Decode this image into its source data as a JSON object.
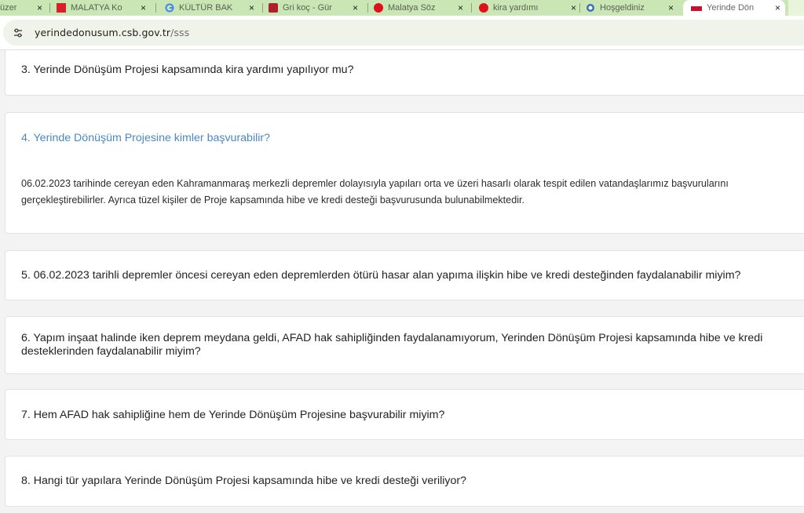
{
  "browser": {
    "tabs": [
      {
        "label": "üzer",
        "favicon": "globe"
      },
      {
        "label": "MALATYA Ko",
        "favicon": "flag-red"
      },
      {
        "label": "KÜLTÜR BAK",
        "favicon": "google"
      },
      {
        "label": "Gri koç - Gür",
        "favicon": "red-square"
      },
      {
        "label": "Malatya Söz",
        "favicon": "red-circle"
      },
      {
        "label": "kira yardımı",
        "favicon": "red-circle"
      },
      {
        "label": "Hoşgeldiniz",
        "favicon": "seal"
      },
      {
        "label": "Yerinde Dön",
        "favicon": "ministry",
        "active": true
      }
    ],
    "close_glyph": "×",
    "address": {
      "domain": "yerindedonusum.csb.gov.tr",
      "path": "/sss"
    }
  },
  "faq": {
    "items": [
      {
        "question": "3. Yerinde Dönüşüm Projesi kapsamında kira yardımı yapılıyor mu?"
      },
      {
        "question": "4. Yerinde Dönüşüm Projesine kimler başvurabilir?",
        "answer": "06.02.2023 tarihinde cereyan eden Kahramanmaraş merkezli depremler dolayısıyla yapıları orta ve üzeri hasarlı olarak tespit edilen vatandaşlarımız başvurularını gerçekleştirebilirler. Ayrıca tüzel kişiler de Proje kapsamında hibe ve kredi desteği başvurusunda bulunabilmektedir."
      },
      {
        "question": "5. 06.02.2023 tarihli depremler öncesi cereyan eden depremlerden ötürü hasar alan yapıma ilişkin hibe ve kredi desteğinden faydalanabilir miyim?"
      },
      {
        "question": "6. Yapım inşaat halinde iken deprem meydana geldi, AFAD hak sahipliğinden faydalanamıyorum, Yerinden Dönüşüm Projesi kapsamında hibe ve kredi desteklerinden faydalanabilir miyim?"
      },
      {
        "question": "7. Hem AFAD hak sahipliğine hem de Yerinde Dönüşüm Projesine başvurabilir miyim?"
      },
      {
        "question": "8. Hangi tür yapılara Yerinde Dönüşüm Projesi kapsamında hibe ve kredi desteği veriliyor?"
      }
    ]
  },
  "colors": {
    "open_question": "#4a87c8",
    "tabstrip": "#c9e6b4"
  }
}
